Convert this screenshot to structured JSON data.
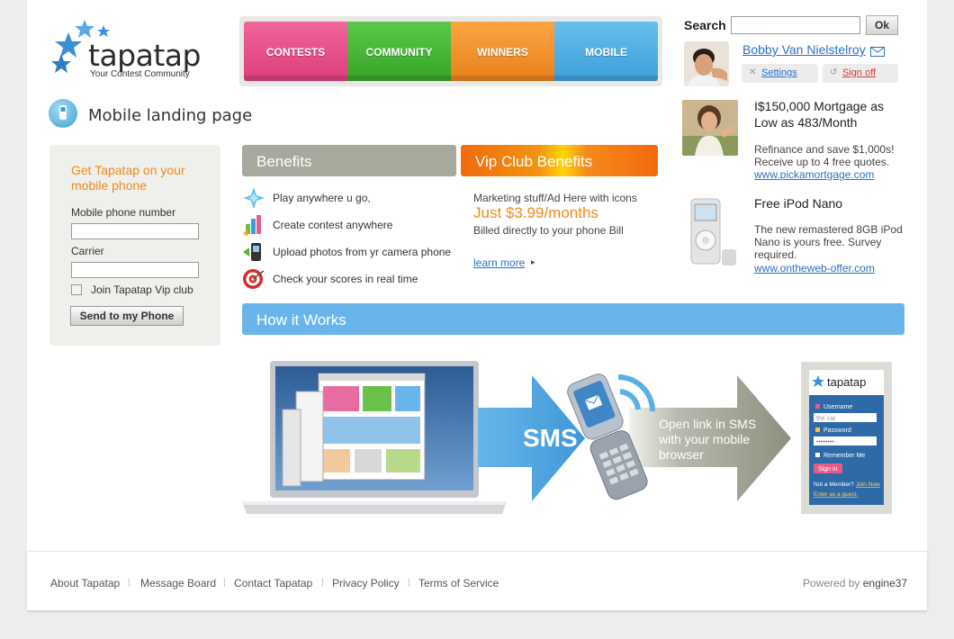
{
  "brand": {
    "name": "tapatap",
    "tagline": "Your Contest Community"
  },
  "nav": [
    {
      "label": "CONTESTS"
    },
    {
      "label": "COMMUNITY"
    },
    {
      "label": "WINNERS"
    },
    {
      "label": "MOBILE"
    }
  ],
  "search": {
    "label": "Search",
    "value": "",
    "button": "Ok"
  },
  "user": {
    "name": "Bobby Van Nielstelroy",
    "settings": "Settings",
    "signoff": "Sign off"
  },
  "page": {
    "title": "Mobile landing page"
  },
  "signup_form": {
    "title": "Get Tapatap on your mobile phone",
    "phone_label": "Mobile phone number",
    "phone_value": "",
    "carrier_label": "Carrier",
    "carrier_value": "",
    "vip_checkbox": "Join Tapatap Vip club",
    "vip_checked": false,
    "submit": "Send to my Phone"
  },
  "benefits": {
    "title": "Benefits",
    "items": [
      {
        "icon": "sparkle-arrows-icon",
        "text": "Play anywhere u go,"
      },
      {
        "icon": "bar-chart-icon",
        "text": "Create contest anywhere"
      },
      {
        "icon": "camera-phone-icon",
        "text": "Upload photos from yr camera phone"
      },
      {
        "icon": "target-icon",
        "text": "Check your scores in real time"
      }
    ]
  },
  "vip": {
    "title": "Vip Club Benefits",
    "desc": "Marketing stuff/Ad Here with icons",
    "price": "Just $3.99/months",
    "billing": "Billed directly to your phone Bill",
    "link": "learn more"
  },
  "ads": [
    {
      "title": "I$150,000 Mortgage as Low as 483/Month",
      "text": "Refinance and save $1,000s! Receive up to 4 free quotes.",
      "link": "www.pickamortgage.com"
    },
    {
      "title": "Free iPod Nano",
      "text": "The new remastered 8GB iPod Nano is yours free. Survey required.",
      "link": "www.ontheweb-offer.com"
    }
  ],
  "how": {
    "title": "How it Works",
    "sms": "SMS",
    "open_link": [
      "Open link in SMS",
      "with your mobile",
      "browser"
    ],
    "mobile_login": {
      "brand": "tapatap",
      "username_label": "Username",
      "username_value": "the cat",
      "password_label": "Password",
      "password_value": "••••••••",
      "remember": "Remember Me",
      "signin": "Sign in",
      "not_member": "Not a Member?",
      "join": "Join Now",
      "guest": "Enter as a guest."
    }
  },
  "footer": {
    "links": [
      "About Tapatap",
      "Message Board",
      "Contact Tapatap",
      "Privacy Policy",
      "Terms of Service"
    ],
    "powered_prefix": "Powered by",
    "powered_brand": "engine37"
  },
  "colors": {
    "contests": "#dc3e7c",
    "community": "#36a429",
    "winners": "#e9811b",
    "mobile": "#3d9fd8",
    "accent_orange": "#f08a1a",
    "link_blue": "#2b6fc7"
  }
}
